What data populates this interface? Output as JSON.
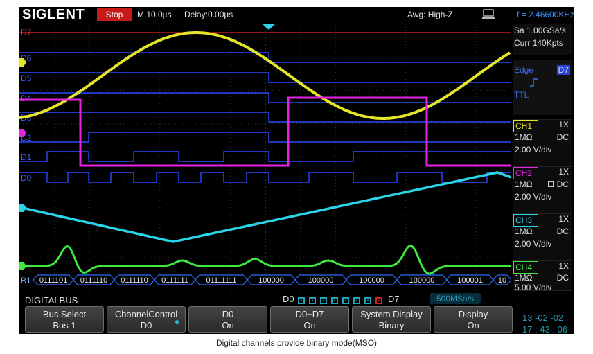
{
  "topbar": {
    "brand": "SIGLENT",
    "status": "Stop",
    "timebase": "M 10.0µs",
    "delay": "Delay:0.00µs",
    "input_impedance": "Awg: High-Z",
    "trigger_freq": "f = 2.46600KHz"
  },
  "acquisition": {
    "sample_rate": "Sa 1.00GSa/s",
    "memory_depth": "Curr 140Kpts"
  },
  "trigger": {
    "type": "Edge",
    "source": "D7",
    "slope_icon": "rising-edge-icon",
    "level_type": "TTL"
  },
  "channels": [
    {
      "name": "CH1",
      "probe": "1X",
      "impedance": "1MΩ",
      "coupling": "DC",
      "vdiv": "2.00 V/div",
      "color": "#e5e52a"
    },
    {
      "name": "CH2",
      "probe": "1X",
      "impedance": "1MΩ",
      "coupling": "DC",
      "vdiv": "2.00 V/div",
      "color": "#e324e3"
    },
    {
      "name": "CH3",
      "probe": "1X",
      "impedance": "1MΩ",
      "coupling": "DC",
      "vdiv": "2.00 V/div",
      "color": "#2bd3e6"
    },
    {
      "name": "CH4",
      "probe": "1X",
      "impedance": "1MΩ",
      "coupling": "DC",
      "vdiv": "5.00 V/div",
      "color": "#3ee83e"
    }
  ],
  "digital_labels": [
    "D7",
    "D6",
    "D5",
    "D4",
    "D3",
    "D2",
    "D1",
    "D0"
  ],
  "digital_color": "#2a4bff",
  "trigger_line_color": "#c81a1a",
  "bus": {
    "label": "B1",
    "values": [
      "0111101",
      "0111110",
      "0111110",
      "0111111",
      "01111111",
      "100000",
      "100000",
      "100000",
      "100000",
      "100001",
      "10"
    ]
  },
  "menu": {
    "title": "DIGITALBUS",
    "status_start": "D0",
    "status_end": "D7",
    "rate": "500MSa/s",
    "softkeys": [
      {
        "l1": "Bus Select",
        "l2": "Bus 1"
      },
      {
        "l1": "ChannelControl",
        "l2": "D0"
      },
      {
        "l1": "D0",
        "l2": "On"
      },
      {
        "l1": "D0~D7",
        "l2": "On"
      },
      {
        "l1": "System Display",
        "l2": "Binary"
      },
      {
        "l1": "Display",
        "l2": "On"
      }
    ]
  },
  "datetime": {
    "date": "13 -02 -02",
    "time": "17 : 43 : 06"
  },
  "caption": "Digital channels provide binary mode(MSO)"
}
